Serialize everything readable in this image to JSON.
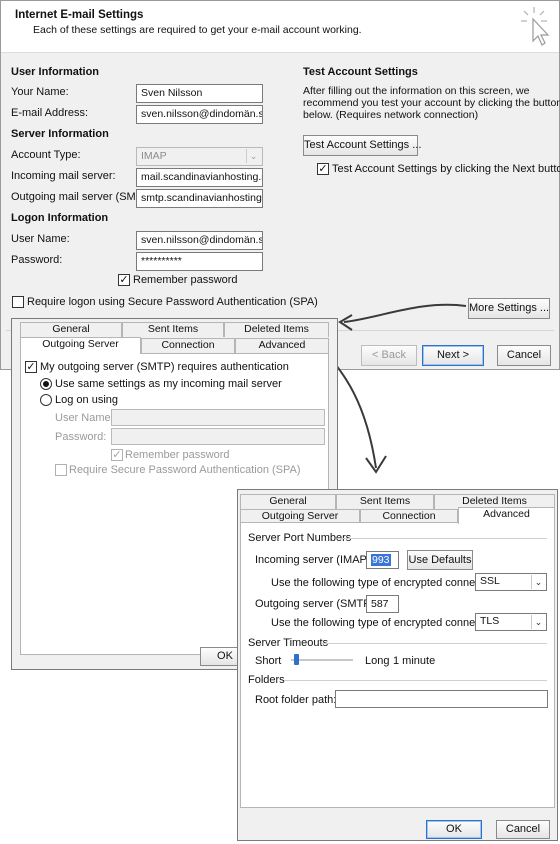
{
  "main": {
    "title": "Internet E-mail Settings",
    "subtitle": "Each of these settings are required to get your e-mail account working.",
    "user_info": {
      "heading": "User Information",
      "your_name_label": "Your Name:",
      "your_name_value": "Sven Nilsson",
      "email_label": "E-mail Address:",
      "email_value": "sven.nilsson@dindomän.se"
    },
    "server_info": {
      "heading": "Server Information",
      "account_type_label": "Account Type:",
      "account_type_value": "IMAP",
      "incoming_label": "Incoming mail server:",
      "incoming_value": "mail.scandinavianhosting.se",
      "outgoing_label": "Outgoing mail server (SMTP):",
      "outgoing_value": "smtp.scandinavianhosting.se"
    },
    "logon_info": {
      "heading": "Logon Information",
      "username_label": "User Name:",
      "username_value": "sven.nilsson@dindomän.se",
      "password_label": "Password:",
      "password_value": "**********",
      "remember_label": "Remember password",
      "spa_label": "Require logon using Secure Password Authentication (SPA)"
    },
    "test": {
      "heading": "Test Account Settings",
      "description": [
        "After filling out the information on this screen, we",
        "recommend you test your account by clicking the button",
        "below. (Requires network connection)"
      ],
      "button_label": "Test Account Settings ...",
      "checkbox_label": "Test Account Settings by clicking the Next button"
    },
    "more_settings_label": "More Settings ...",
    "back_label": "< Back",
    "next_label": "Next >",
    "cancel_label": "Cancel"
  },
  "outgoing_dialog": {
    "tabs_top": [
      "General",
      "Sent Items",
      "Deleted Items"
    ],
    "tabs_bottom": [
      "Outgoing Server",
      "Connection",
      "Advanced"
    ],
    "requires_auth_label": "My outgoing server (SMTP) requires authentication",
    "same_settings_label": "Use same settings as my incoming mail server",
    "log_on_label": "Log on using",
    "user_name_label": "User Name:",
    "password_label": "Password:",
    "remember_label": "Remember password",
    "spa_label": "Require Secure Password Authentication (SPA)",
    "ok_label": "OK"
  },
  "advanced_dialog": {
    "tabs_top": [
      "General",
      "Sent Items",
      "Deleted Items"
    ],
    "tabs_bottom": [
      "Outgoing Server",
      "Connection",
      "Advanced"
    ],
    "port_heading": "Server Port Numbers",
    "incoming_label": "Incoming server (IMAP):",
    "incoming_port": "993",
    "use_defaults_label": "Use Defaults",
    "enc_label": "Use the following type of encrypted connection:",
    "incoming_enc": "SSL",
    "outgoing_label": "Outgoing server (SMTP):",
    "outgoing_port": "587",
    "outgoing_enc": "TLS",
    "timeouts_heading": "Server Timeouts",
    "short_label": "Short",
    "long_label": "Long",
    "timeout_value": "1 minute",
    "timeout_level": 0.05,
    "folders_heading": "Folders",
    "root_folder_label": "Root folder path:",
    "root_folder_value": "",
    "ok_label": "OK",
    "cancel_label": "Cancel"
  }
}
